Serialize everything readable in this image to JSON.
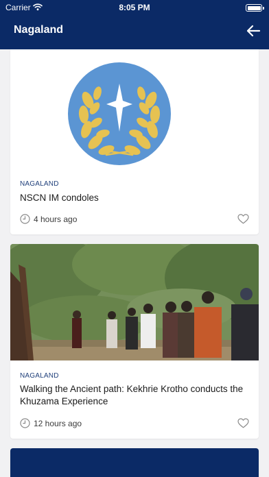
{
  "status_bar": {
    "carrier": "Carrier",
    "time": "8:05 PM"
  },
  "nav": {
    "title": "Nagaland"
  },
  "articles": [
    {
      "category": "NAGALAND",
      "title": "NSCN IM condoles",
      "time_ago": "4 hours ago"
    },
    {
      "category": "NAGALAND",
      "title": "Walking the Ancient path: Kekhrie Krotho conducts the Khuzama Experience",
      "time_ago": "12 hours ago"
    }
  ],
  "colors": {
    "nav_bar": "#0b2a66",
    "category_text": "#1f3f7a",
    "background": "#f1f1f3",
    "emblem_blue": "#5b95d3",
    "laurel_gold": "#e6c252"
  },
  "icons": {
    "wifi": "wifi-icon",
    "battery": "battery-icon",
    "back": "back-arrow-icon",
    "clock": "clock-icon",
    "favorite": "heart-icon"
  }
}
